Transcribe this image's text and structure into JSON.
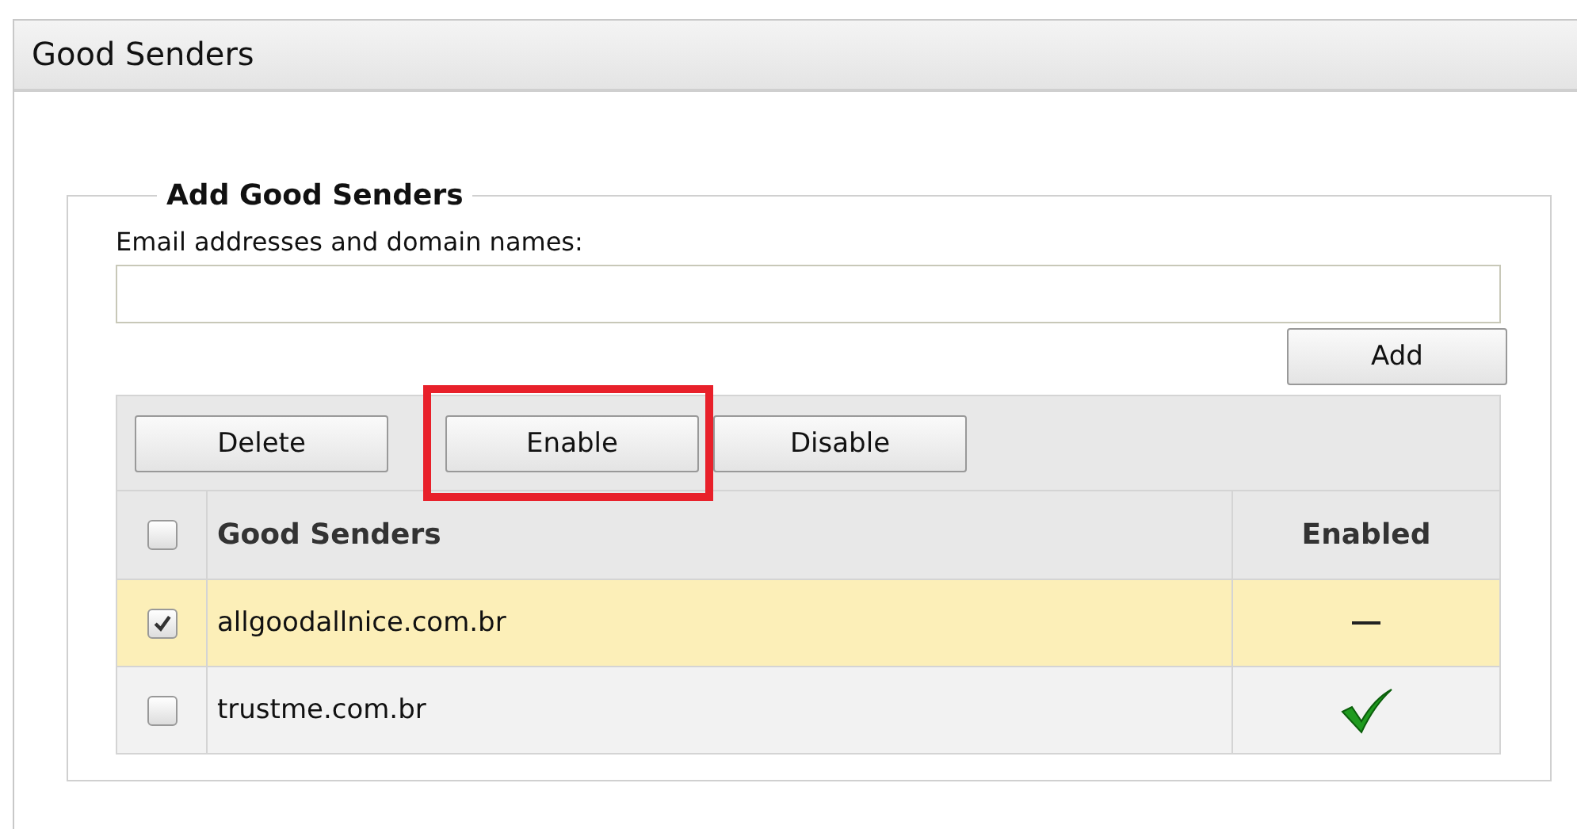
{
  "panel": {
    "title": "Good Senders"
  },
  "section": {
    "legend": "Add Good Senders",
    "field_label": "Email addresses and domain names:",
    "add_button": "Add"
  },
  "toolbar": [
    {
      "label": "Delete",
      "highlighted": false
    },
    {
      "label": "Enable",
      "highlighted": true
    },
    {
      "label": "Disable",
      "highlighted": false
    }
  ],
  "table": {
    "select_all_checked": false,
    "columns": [
      "Good Senders",
      "Enabled"
    ],
    "rows": [
      {
        "sender": "allgoodallnice.com.br",
        "checked": true,
        "enabled": false
      },
      {
        "sender": "trustme.com.br",
        "checked": false,
        "enabled": true
      }
    ]
  }
}
